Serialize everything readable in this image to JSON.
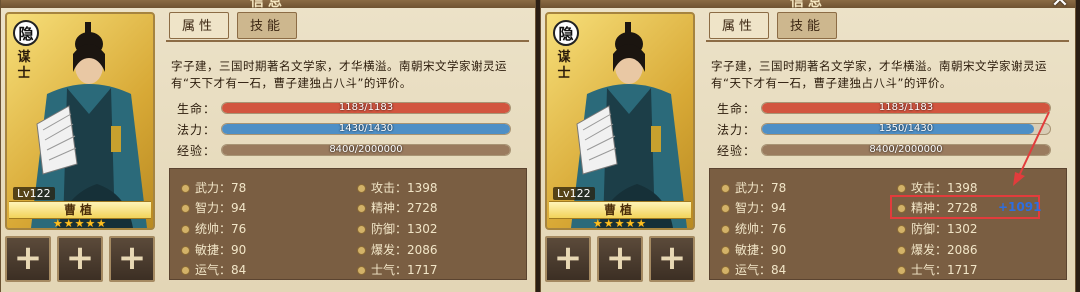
{
  "left": {
    "title": "信息",
    "close_label": "✕",
    "badge": "隐",
    "class_tag": "谋士",
    "level": "Lv122",
    "name": "曹植",
    "stars": "★★★★★",
    "tabs": [
      {
        "label": "属性"
      },
      {
        "label": "技能"
      }
    ],
    "description": "字子建，三国时期著名文学家，才华横溢。南朝宋文学家谢灵运有“天下才有一石，曹子建独占八斗”的评价。",
    "bars": {
      "hp": {
        "label": "生命：",
        "text": "1183/1183",
        "fill": 1.0,
        "color": "#d2553f"
      },
      "mp": {
        "label": "法力：",
        "text": "1430/1430",
        "fill": 1.0,
        "color": "#4e8fc6"
      },
      "exp": {
        "label": "经验：",
        "text": "8400/2000000",
        "fill": 1.0,
        "color": "#9a7b5e"
      }
    },
    "stats_left": [
      "武力：78",
      "智力：94",
      "统帅：76",
      "敏捷：90",
      "运气：84"
    ],
    "stats_right": [
      "攻击：1398",
      "精神：2728",
      "防御：1302",
      "爆发：2086",
      "士气：1717"
    ],
    "plus": "+"
  },
  "right": {
    "title": "信息",
    "close_label": "✕",
    "badge": "隐",
    "class_tag": "谋士",
    "level": "Lv122",
    "name": "曹植",
    "stars": "★★★★★",
    "tabs": [
      {
        "label": "属性"
      },
      {
        "label": "技能"
      }
    ],
    "description": "字子建，三国时期著名文学家，才华横溢。南朝宋文学家谢灵运有“天下才有一石，曹子建独占八斗”的评价。",
    "bars": {
      "hp": {
        "label": "生命：",
        "text": "1183/1183",
        "fill": 1.0,
        "color": "#d2553f"
      },
      "mp": {
        "label": "法力：",
        "text": "1350/1430",
        "fill": 0.944,
        "color": "#4e8fc6"
      },
      "exp": {
        "label": "经验：",
        "text": "8400/2000000",
        "fill": 1.0,
        "color": "#9a7b5e"
      }
    },
    "stats_left": [
      "武力：78",
      "智力：94",
      "统帅：76",
      "敏捷：90",
      "运气：84"
    ],
    "stats_right": [
      "攻击：1398",
      "精神：2728",
      "防御：1302",
      "爆发：2086",
      "士气：1717"
    ],
    "bonus": "+1091",
    "annotation_color": "#e23c3c",
    "plus": "+"
  }
}
